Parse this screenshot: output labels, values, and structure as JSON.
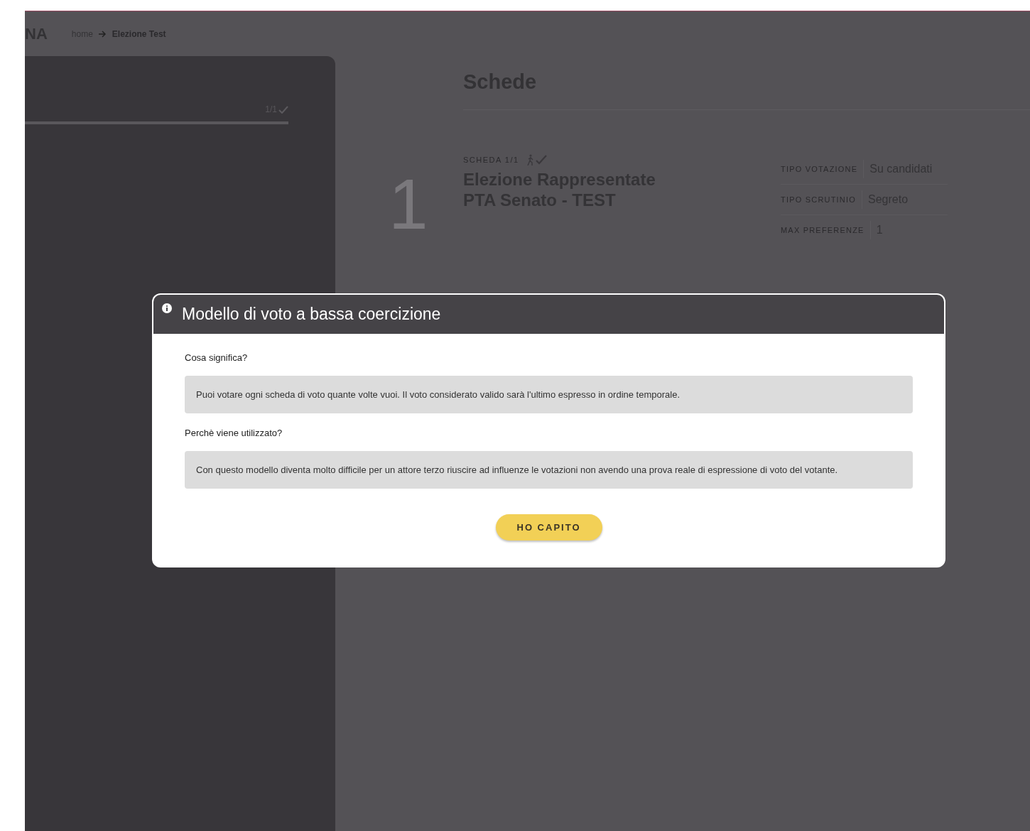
{
  "header": {
    "logo": "NA",
    "breadcrumb": [
      {
        "label": "home",
        "current": false
      },
      {
        "label": "Elezione Test",
        "current": true
      }
    ]
  },
  "sidebar": {
    "progress": "1/1",
    "level": 1
  },
  "content": {
    "title": "Schede",
    "ballot": {
      "number": "1",
      "label": "SCHEDA 1/1",
      "title": "Elezione Rappresentate PTA Senato - TEST",
      "details": [
        {
          "label": "TIPO VOTAZIONE",
          "value": "Su candidati"
        },
        {
          "label": "TIPO SCRUTINIO",
          "value": "Segreto"
        },
        {
          "label": "MAX PREFERENZE",
          "value": "1"
        }
      ]
    }
  },
  "modal": {
    "title": "Modello di voto a bassa coercizione",
    "sections": [
      {
        "question": "Cosa significa?",
        "answer": "Puoi votare ogni scheda di voto quante volte vuoi. Il voto considerato valido sarà l'ultimo espresso in ordine temporale."
      },
      {
        "question": "Perchè viene utilizzato?",
        "answer": "Con questo modello diventa molto difficile per un attore terzo riuscire ad influenze le votazioni non avendo una prova reale di espressione di voto del votante."
      }
    ],
    "button": "HO CAPITO"
  }
}
